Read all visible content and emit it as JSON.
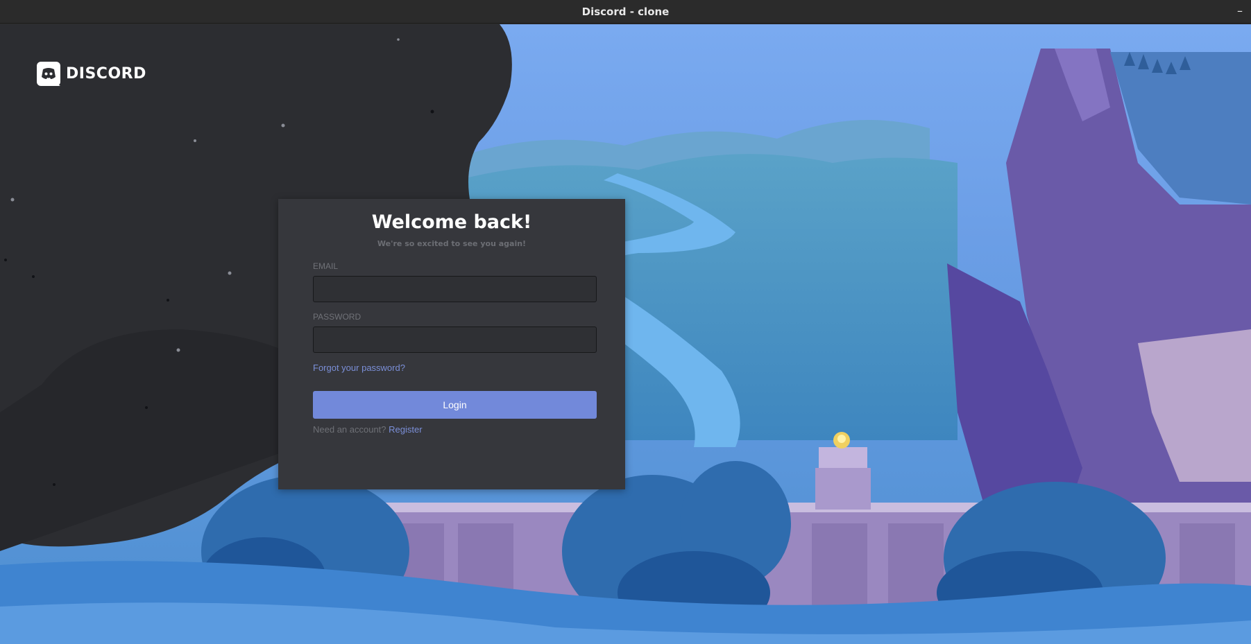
{
  "window": {
    "title": "Discord - clone",
    "minimize_label": "–"
  },
  "brand": {
    "name": "DISCORD",
    "accent": "#7289da"
  },
  "login": {
    "heading": "Welcome back!",
    "subheading": "We're so excited to see you again!",
    "email_label": "EMAIL",
    "email_value": "",
    "password_label": "PASSWORD",
    "password_value": "",
    "forgot_link": "Forgot your password?",
    "submit_label": "Login",
    "register_prompt": "Need an account?",
    "register_link": "Register"
  },
  "colors": {
    "card_bg": "#36373c",
    "input_bg": "#2f3034",
    "link": "#7b8fd8",
    "dark_blob": "#2c2d31"
  }
}
